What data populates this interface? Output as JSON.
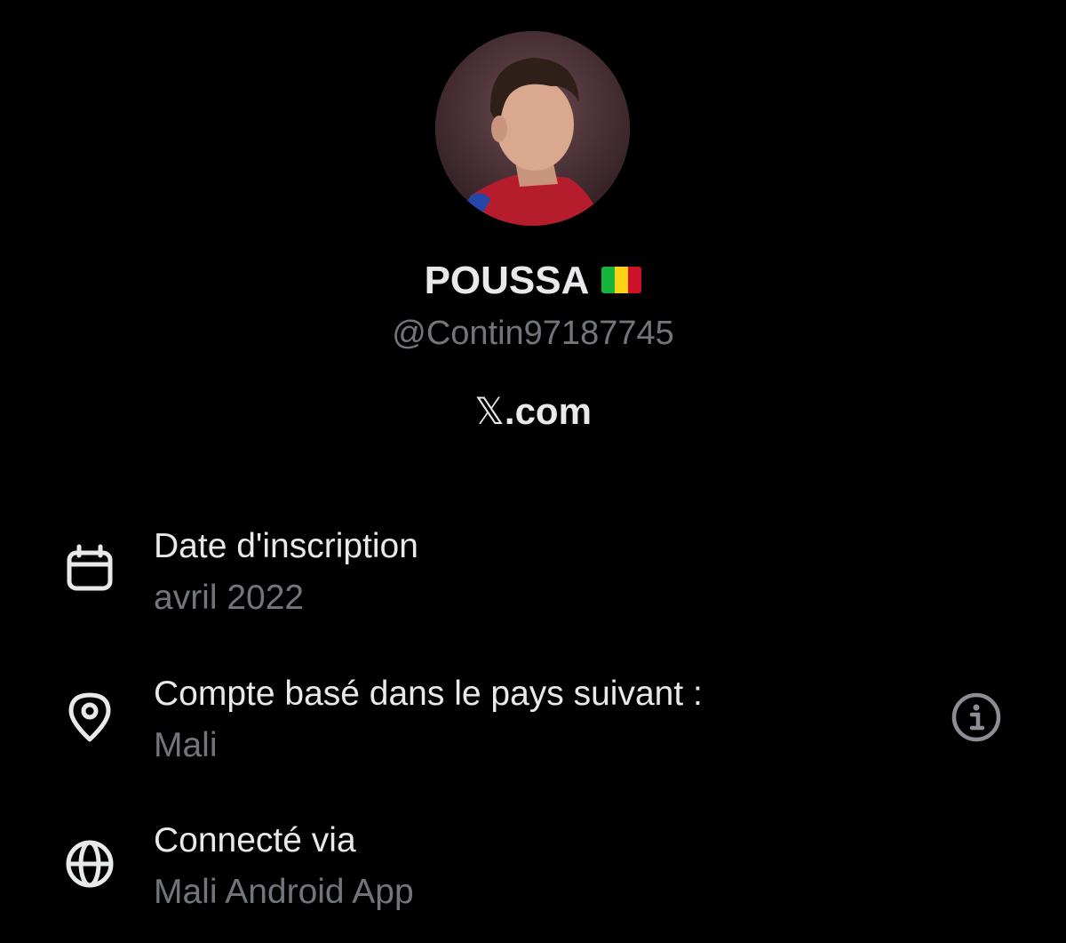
{
  "profile": {
    "display_name": "POUSSA",
    "flag": "Mali",
    "handle": "@Contin97187745",
    "site": "X.com",
    "site_prefix": "𝕏",
    "site_suffix": ".com"
  },
  "details": [
    {
      "icon": "calendar-icon",
      "title": "Date d'inscription",
      "value": "avril 2022"
    },
    {
      "icon": "location-pin-icon",
      "title": "Compte basé dans le pays suivant :",
      "value": "Mali",
      "action_icon": "info-icon"
    },
    {
      "icon": "globe-icon",
      "title": "Connecté via",
      "value": "Mali Android App"
    }
  ],
  "colors": {
    "background": "#000000",
    "primary_text": "#e7e9ea",
    "secondary_text": "#71767b",
    "flag_green": "#14b53a",
    "flag_yellow": "#fcd116",
    "flag_red": "#ce1126"
  }
}
